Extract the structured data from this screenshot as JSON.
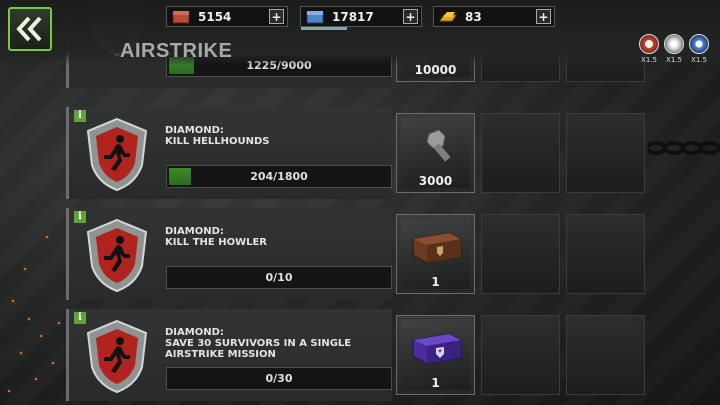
{
  "header": {
    "title": "AIRSTRIKE",
    "currencies": [
      {
        "icon": "supply-crate-icon",
        "value": "5154",
        "plus": "+",
        "color": "#b84a36"
      },
      {
        "icon": "blue-bricks-icon",
        "value": "17817",
        "plus": "+",
        "color": "#4f86d0"
      },
      {
        "icon": "gold-bars-icon",
        "value": "83",
        "plus": "+",
        "color": "#e6a420"
      }
    ],
    "boosts": [
      {
        "icon": "red-crate-boost-icon",
        "label": "X1.5"
      },
      {
        "icon": "white-orb-boost-icon",
        "label": "X1.5"
      },
      {
        "icon": "blue-crate-boost-icon",
        "label": "X1.5"
      }
    ]
  },
  "missions": [
    {
      "progress_text": "1225/9000",
      "progress": 0.136,
      "reward_qty": "10000",
      "reward_icon": "bolt-icon"
    },
    {
      "tier": "DIAMOND:",
      "task": "KILL HELLHOUNDS",
      "progress_text": "204/1800",
      "progress": 0.113,
      "reward_qty": "3000",
      "reward_icon": "bolt-icon"
    },
    {
      "tier": "DIAMOND:",
      "task": "KILL THE HOWLER",
      "progress_text": "0/10",
      "progress": 0,
      "reward_qty": "1",
      "reward_icon": "brown-crate-icon"
    },
    {
      "tier": "DIAMOND:",
      "task": "SAVE 30 SURVIVORS IN A SINGLE",
      "task2": "AIRSTRIKE MISSION",
      "progress_text": "0/30",
      "progress": 0,
      "reward_qty": "1",
      "reward_icon": "purple-crate-icon"
    }
  ]
}
